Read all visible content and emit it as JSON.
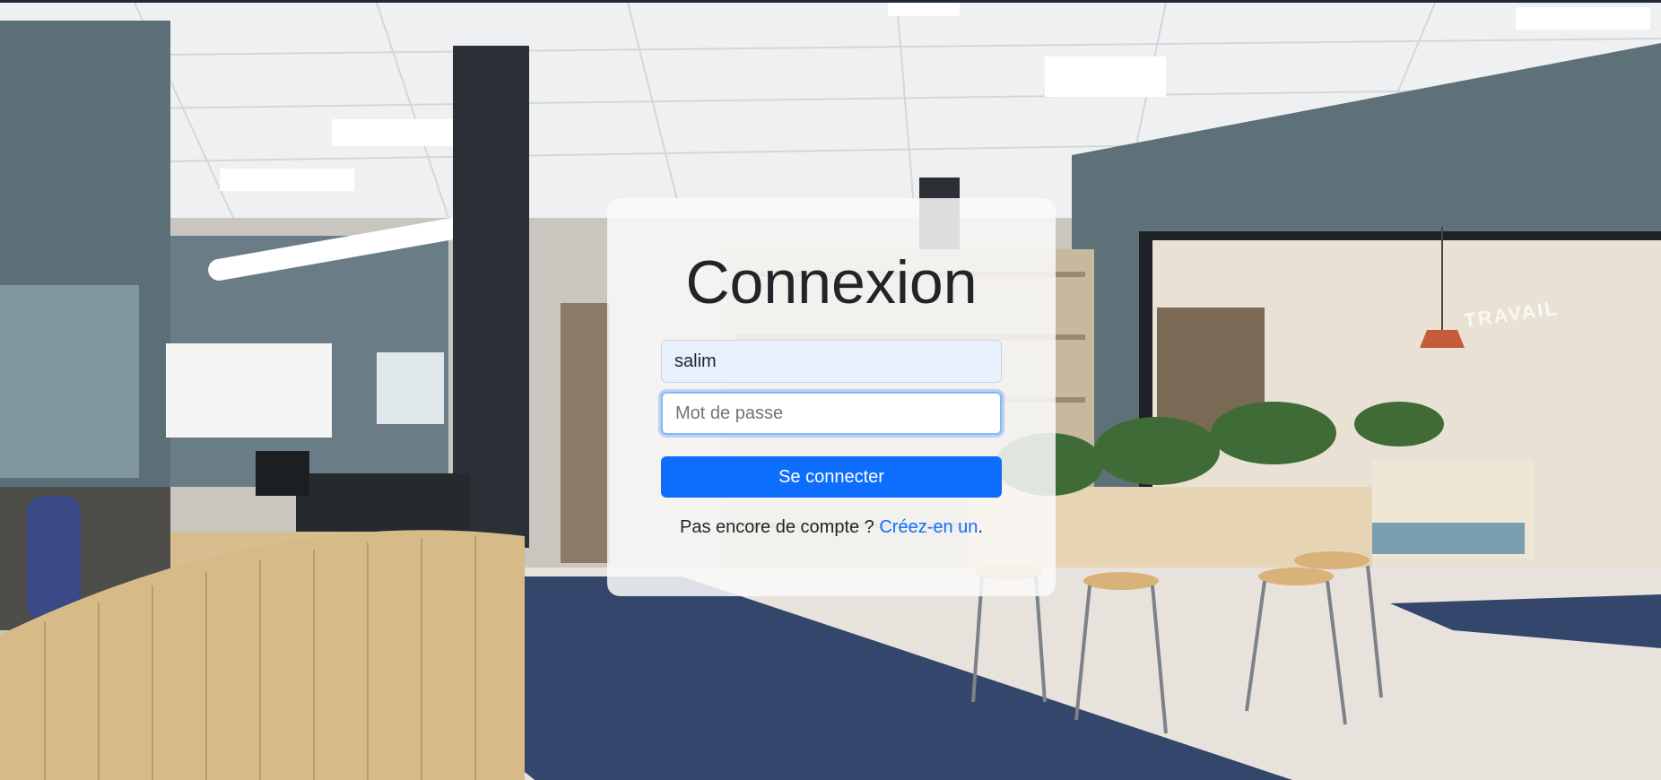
{
  "login": {
    "title": "Connexion",
    "username_value": "salim",
    "password_placeholder": "Mot de passe",
    "submit_label": "Se connecter",
    "signup_prompt": "Pas encore de compte ? ",
    "signup_link": "Créez-en un",
    "signup_suffix": "."
  },
  "theme": {
    "accent": "#0d6efd",
    "card_bg": "#fafafa",
    "focus_ring": "#86b7fe",
    "autofill_bg": "#e8f0fe"
  },
  "background": {
    "icon": "library-photo",
    "sign_text": "TRAVAIL"
  }
}
